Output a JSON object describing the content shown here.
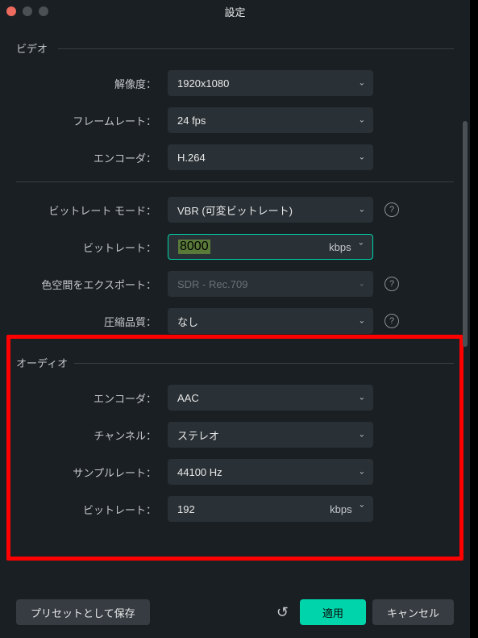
{
  "window": {
    "title": "設定"
  },
  "sections": {
    "video": "ビデオ",
    "audio": "オーディオ"
  },
  "video": {
    "resolution": {
      "label": "解像度：",
      "value": "1920x1080"
    },
    "framerate": {
      "label": "フレームレート：",
      "value": "24 fps"
    },
    "encoder": {
      "label": "エンコーダ：",
      "value": "H.264"
    },
    "bitrateMode": {
      "label": "ビットレート モード：",
      "value": "VBR (可変ビットレート)"
    },
    "bitrate": {
      "label": "ビットレート：",
      "value": "8000",
      "unit": "kbps"
    },
    "colorSpace": {
      "label": "色空間をエクスポート：",
      "value": "SDR - Rec.709"
    },
    "compression": {
      "label": "圧縮品質：",
      "value": "なし"
    }
  },
  "audio": {
    "encoder": {
      "label": "エンコーダ：",
      "value": "AAC"
    },
    "channel": {
      "label": "チャンネル：",
      "value": "ステレオ"
    },
    "sampleRate": {
      "label": "サンプルレート：",
      "value": "44100 Hz"
    },
    "bitrate": {
      "label": "ビットレート：",
      "value": "192",
      "unit": "kbps"
    }
  },
  "footer": {
    "savePreset": "プリセットとして保存",
    "apply": "適用",
    "cancel": "キャンセル"
  },
  "icons": {
    "help": "?",
    "chevronDown": "⌄",
    "reset": "↺"
  }
}
